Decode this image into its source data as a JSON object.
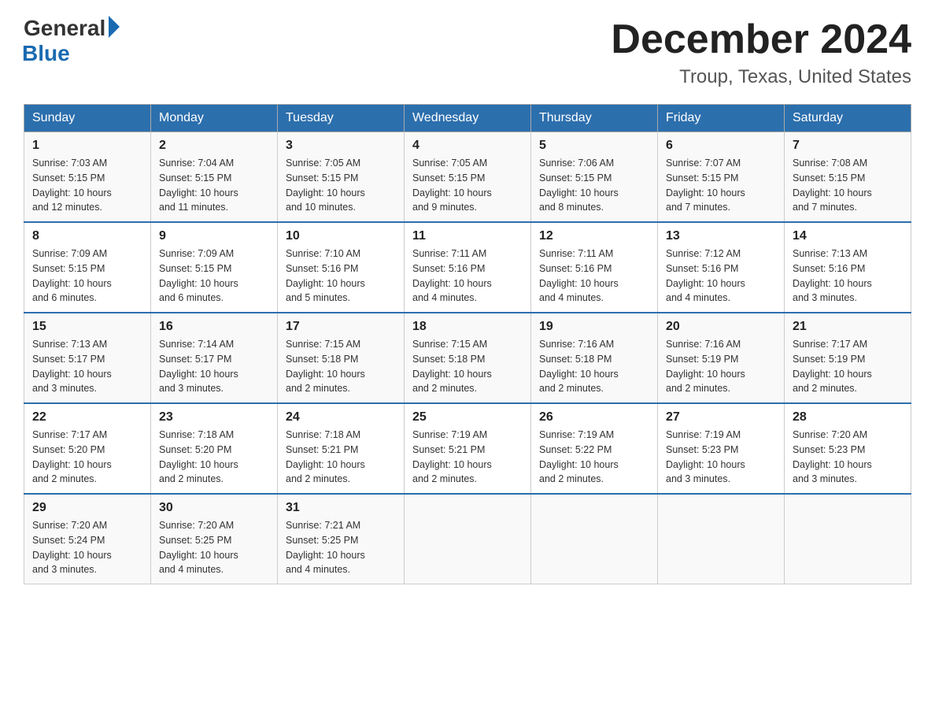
{
  "header": {
    "logo_general": "General",
    "logo_blue": "Blue",
    "main_title": "December 2024",
    "subtitle": "Troup, Texas, United States"
  },
  "weekdays": [
    "Sunday",
    "Monday",
    "Tuesday",
    "Wednesday",
    "Thursday",
    "Friday",
    "Saturday"
  ],
  "weeks": [
    [
      {
        "day": "1",
        "sunrise": "7:03 AM",
        "sunset": "5:15 PM",
        "daylight": "10 hours and 12 minutes."
      },
      {
        "day": "2",
        "sunrise": "7:04 AM",
        "sunset": "5:15 PM",
        "daylight": "10 hours and 11 minutes."
      },
      {
        "day": "3",
        "sunrise": "7:05 AM",
        "sunset": "5:15 PM",
        "daylight": "10 hours and 10 minutes."
      },
      {
        "day": "4",
        "sunrise": "7:05 AM",
        "sunset": "5:15 PM",
        "daylight": "10 hours and 9 minutes."
      },
      {
        "day": "5",
        "sunrise": "7:06 AM",
        "sunset": "5:15 PM",
        "daylight": "10 hours and 8 minutes."
      },
      {
        "day": "6",
        "sunrise": "7:07 AM",
        "sunset": "5:15 PM",
        "daylight": "10 hours and 7 minutes."
      },
      {
        "day": "7",
        "sunrise": "7:08 AM",
        "sunset": "5:15 PM",
        "daylight": "10 hours and 7 minutes."
      }
    ],
    [
      {
        "day": "8",
        "sunrise": "7:09 AM",
        "sunset": "5:15 PM",
        "daylight": "10 hours and 6 minutes."
      },
      {
        "day": "9",
        "sunrise": "7:09 AM",
        "sunset": "5:15 PM",
        "daylight": "10 hours and 6 minutes."
      },
      {
        "day": "10",
        "sunrise": "7:10 AM",
        "sunset": "5:16 PM",
        "daylight": "10 hours and 5 minutes."
      },
      {
        "day": "11",
        "sunrise": "7:11 AM",
        "sunset": "5:16 PM",
        "daylight": "10 hours and 4 minutes."
      },
      {
        "day": "12",
        "sunrise": "7:11 AM",
        "sunset": "5:16 PM",
        "daylight": "10 hours and 4 minutes."
      },
      {
        "day": "13",
        "sunrise": "7:12 AM",
        "sunset": "5:16 PM",
        "daylight": "10 hours and 4 minutes."
      },
      {
        "day": "14",
        "sunrise": "7:13 AM",
        "sunset": "5:16 PM",
        "daylight": "10 hours and 3 minutes."
      }
    ],
    [
      {
        "day": "15",
        "sunrise": "7:13 AM",
        "sunset": "5:17 PM",
        "daylight": "10 hours and 3 minutes."
      },
      {
        "day": "16",
        "sunrise": "7:14 AM",
        "sunset": "5:17 PM",
        "daylight": "10 hours and 3 minutes."
      },
      {
        "day": "17",
        "sunrise": "7:15 AM",
        "sunset": "5:18 PM",
        "daylight": "10 hours and 2 minutes."
      },
      {
        "day": "18",
        "sunrise": "7:15 AM",
        "sunset": "5:18 PM",
        "daylight": "10 hours and 2 minutes."
      },
      {
        "day": "19",
        "sunrise": "7:16 AM",
        "sunset": "5:18 PM",
        "daylight": "10 hours and 2 minutes."
      },
      {
        "day": "20",
        "sunrise": "7:16 AM",
        "sunset": "5:19 PM",
        "daylight": "10 hours and 2 minutes."
      },
      {
        "day": "21",
        "sunrise": "7:17 AM",
        "sunset": "5:19 PM",
        "daylight": "10 hours and 2 minutes."
      }
    ],
    [
      {
        "day": "22",
        "sunrise": "7:17 AM",
        "sunset": "5:20 PM",
        "daylight": "10 hours and 2 minutes."
      },
      {
        "day": "23",
        "sunrise": "7:18 AM",
        "sunset": "5:20 PM",
        "daylight": "10 hours and 2 minutes."
      },
      {
        "day": "24",
        "sunrise": "7:18 AM",
        "sunset": "5:21 PM",
        "daylight": "10 hours and 2 minutes."
      },
      {
        "day": "25",
        "sunrise": "7:19 AM",
        "sunset": "5:21 PM",
        "daylight": "10 hours and 2 minutes."
      },
      {
        "day": "26",
        "sunrise": "7:19 AM",
        "sunset": "5:22 PM",
        "daylight": "10 hours and 2 minutes."
      },
      {
        "day": "27",
        "sunrise": "7:19 AM",
        "sunset": "5:23 PM",
        "daylight": "10 hours and 3 minutes."
      },
      {
        "day": "28",
        "sunrise": "7:20 AM",
        "sunset": "5:23 PM",
        "daylight": "10 hours and 3 minutes."
      }
    ],
    [
      {
        "day": "29",
        "sunrise": "7:20 AM",
        "sunset": "5:24 PM",
        "daylight": "10 hours and 3 minutes."
      },
      {
        "day": "30",
        "sunrise": "7:20 AM",
        "sunset": "5:25 PM",
        "daylight": "10 hours and 4 minutes."
      },
      {
        "day": "31",
        "sunrise": "7:21 AM",
        "sunset": "5:25 PM",
        "daylight": "10 hours and 4 minutes."
      },
      null,
      null,
      null,
      null
    ]
  ],
  "labels": {
    "sunrise": "Sunrise: ",
    "sunset": "Sunset: ",
    "daylight": "Daylight: "
  }
}
